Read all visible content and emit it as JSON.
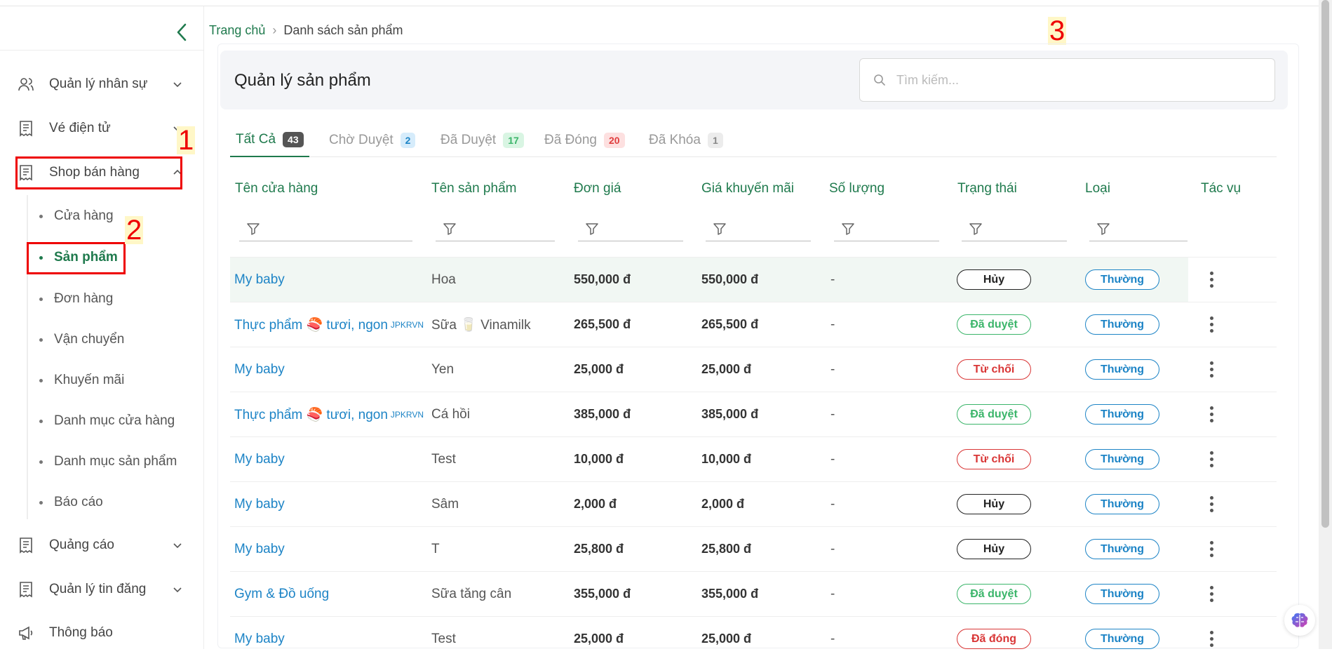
{
  "sidebar": {
    "items": [
      {
        "label": "Quản lý nhân sự",
        "icon": "users-icon"
      },
      {
        "label": "Vé điện tử",
        "icon": "receipt-icon"
      },
      {
        "label": "Shop bán hàng",
        "icon": "receipt-icon"
      },
      {
        "label": "Quảng cáo",
        "icon": "receipt-icon"
      },
      {
        "label": "Quản lý tin đăng",
        "icon": "receipt-icon"
      },
      {
        "label": "Thông báo",
        "icon": "megaphone-icon"
      }
    ],
    "sub_items": [
      "Cửa hàng",
      "Sản phẩm",
      "Đơn hàng",
      "Vận chuyển",
      "Khuyến mãi",
      "Danh mục cửa hàng",
      "Danh mục sản phẩm",
      "Báo cáo"
    ]
  },
  "annotations": [
    "1",
    "2",
    "3"
  ],
  "breadcrumb": {
    "home": "Trang chủ",
    "separator": "›",
    "current": "Danh sách sản phẩm"
  },
  "page": {
    "title": "Quản lý sản phẩm"
  },
  "search": {
    "placeholder": "Tìm kiếm..."
  },
  "tabs": [
    {
      "label": "Tất Cả",
      "count": "43",
      "badge_bg": "#555555",
      "badge_fg": "#ffffff"
    },
    {
      "label": "Chờ Duyệt",
      "count": "2",
      "badge_bg": "#d6ecfb",
      "badge_fg": "#1d84c6"
    },
    {
      "label": "Đã Duyệt",
      "count": "17",
      "badge_bg": "#d9f5e3",
      "badge_fg": "#3bb56a"
    },
    {
      "label": "Đã Đóng",
      "count": "20",
      "badge_bg": "#fde0e0",
      "badge_fg": "#e03e3e"
    },
    {
      "label": "Đã Khóa",
      "count": "1",
      "badge_bg": "#ececec",
      "badge_fg": "#888888"
    }
  ],
  "table": {
    "headers": [
      "Tên cửa hàng",
      "Tên sản phẩm",
      "Đơn giá",
      "Giá khuyến mãi",
      "Số lượng",
      "Trạng thái",
      "Loại",
      "Tác vụ"
    ],
    "rows": [
      {
        "shop": "My baby",
        "shop_tag": "",
        "product": "Hoa",
        "price": "550,000 đ",
        "promo": "550,000 đ",
        "qty": "-",
        "status": "Hủy",
        "type": "Thường"
      },
      {
        "shop": "Thực phẩm 🍣 tươi, ngon",
        "shop_tag": "JPKRVN",
        "product": "Sữa 🥛 Vinamilk",
        "price": "265,500 đ",
        "promo": "265,500 đ",
        "qty": "-",
        "status": "Đã duyệt",
        "type": "Thường"
      },
      {
        "shop": "My baby",
        "shop_tag": "",
        "product": "Yen",
        "price": "25,000 đ",
        "promo": "25,000 đ",
        "qty": "-",
        "status": "Từ chối",
        "type": "Thường"
      },
      {
        "shop": "Thực phẩm 🍣 tươi, ngon",
        "shop_tag": "JPKRVN",
        "product": "Cá hồi",
        "price": "385,000 đ",
        "promo": "385,000 đ",
        "qty": "-",
        "status": "Đã duyệt",
        "type": "Thường"
      },
      {
        "shop": "My baby",
        "shop_tag": "",
        "product": "Test",
        "price": "10,000 đ",
        "promo": "10,000 đ",
        "qty": "-",
        "status": "Từ chối",
        "type": "Thường"
      },
      {
        "shop": "My baby",
        "shop_tag": "",
        "product": "Sâm",
        "price": "2,000 đ",
        "promo": "2,000 đ",
        "qty": "-",
        "status": "Hủy",
        "type": "Thường"
      },
      {
        "shop": "My baby",
        "shop_tag": "",
        "product": "T",
        "price": "25,800 đ",
        "promo": "25,800 đ",
        "qty": "-",
        "status": "Hủy",
        "type": "Thường"
      },
      {
        "shop": "Gym & Đồ uống",
        "shop_tag": "",
        "product": "Sữa tăng cân",
        "price": "355,000 đ",
        "promo": "355,000 đ",
        "qty": "-",
        "status": "Đã duyệt",
        "type": "Thường"
      },
      {
        "shop": "My baby",
        "shop_tag": "",
        "product": "Test",
        "price": "25,000 đ",
        "promo": "25,000 đ",
        "qty": "-",
        "status": "Đã đóng",
        "type": "Thường"
      }
    ]
  },
  "colors": {
    "accent": "#1f7a4d",
    "link": "#1d84c6",
    "status_cancel": "#222222",
    "status_approved": "#3bb56a",
    "status_rejected": "#d93636",
    "status_closed": "#d93636",
    "type_regular": "#1d84c6",
    "annotation": "#ee0000"
  }
}
